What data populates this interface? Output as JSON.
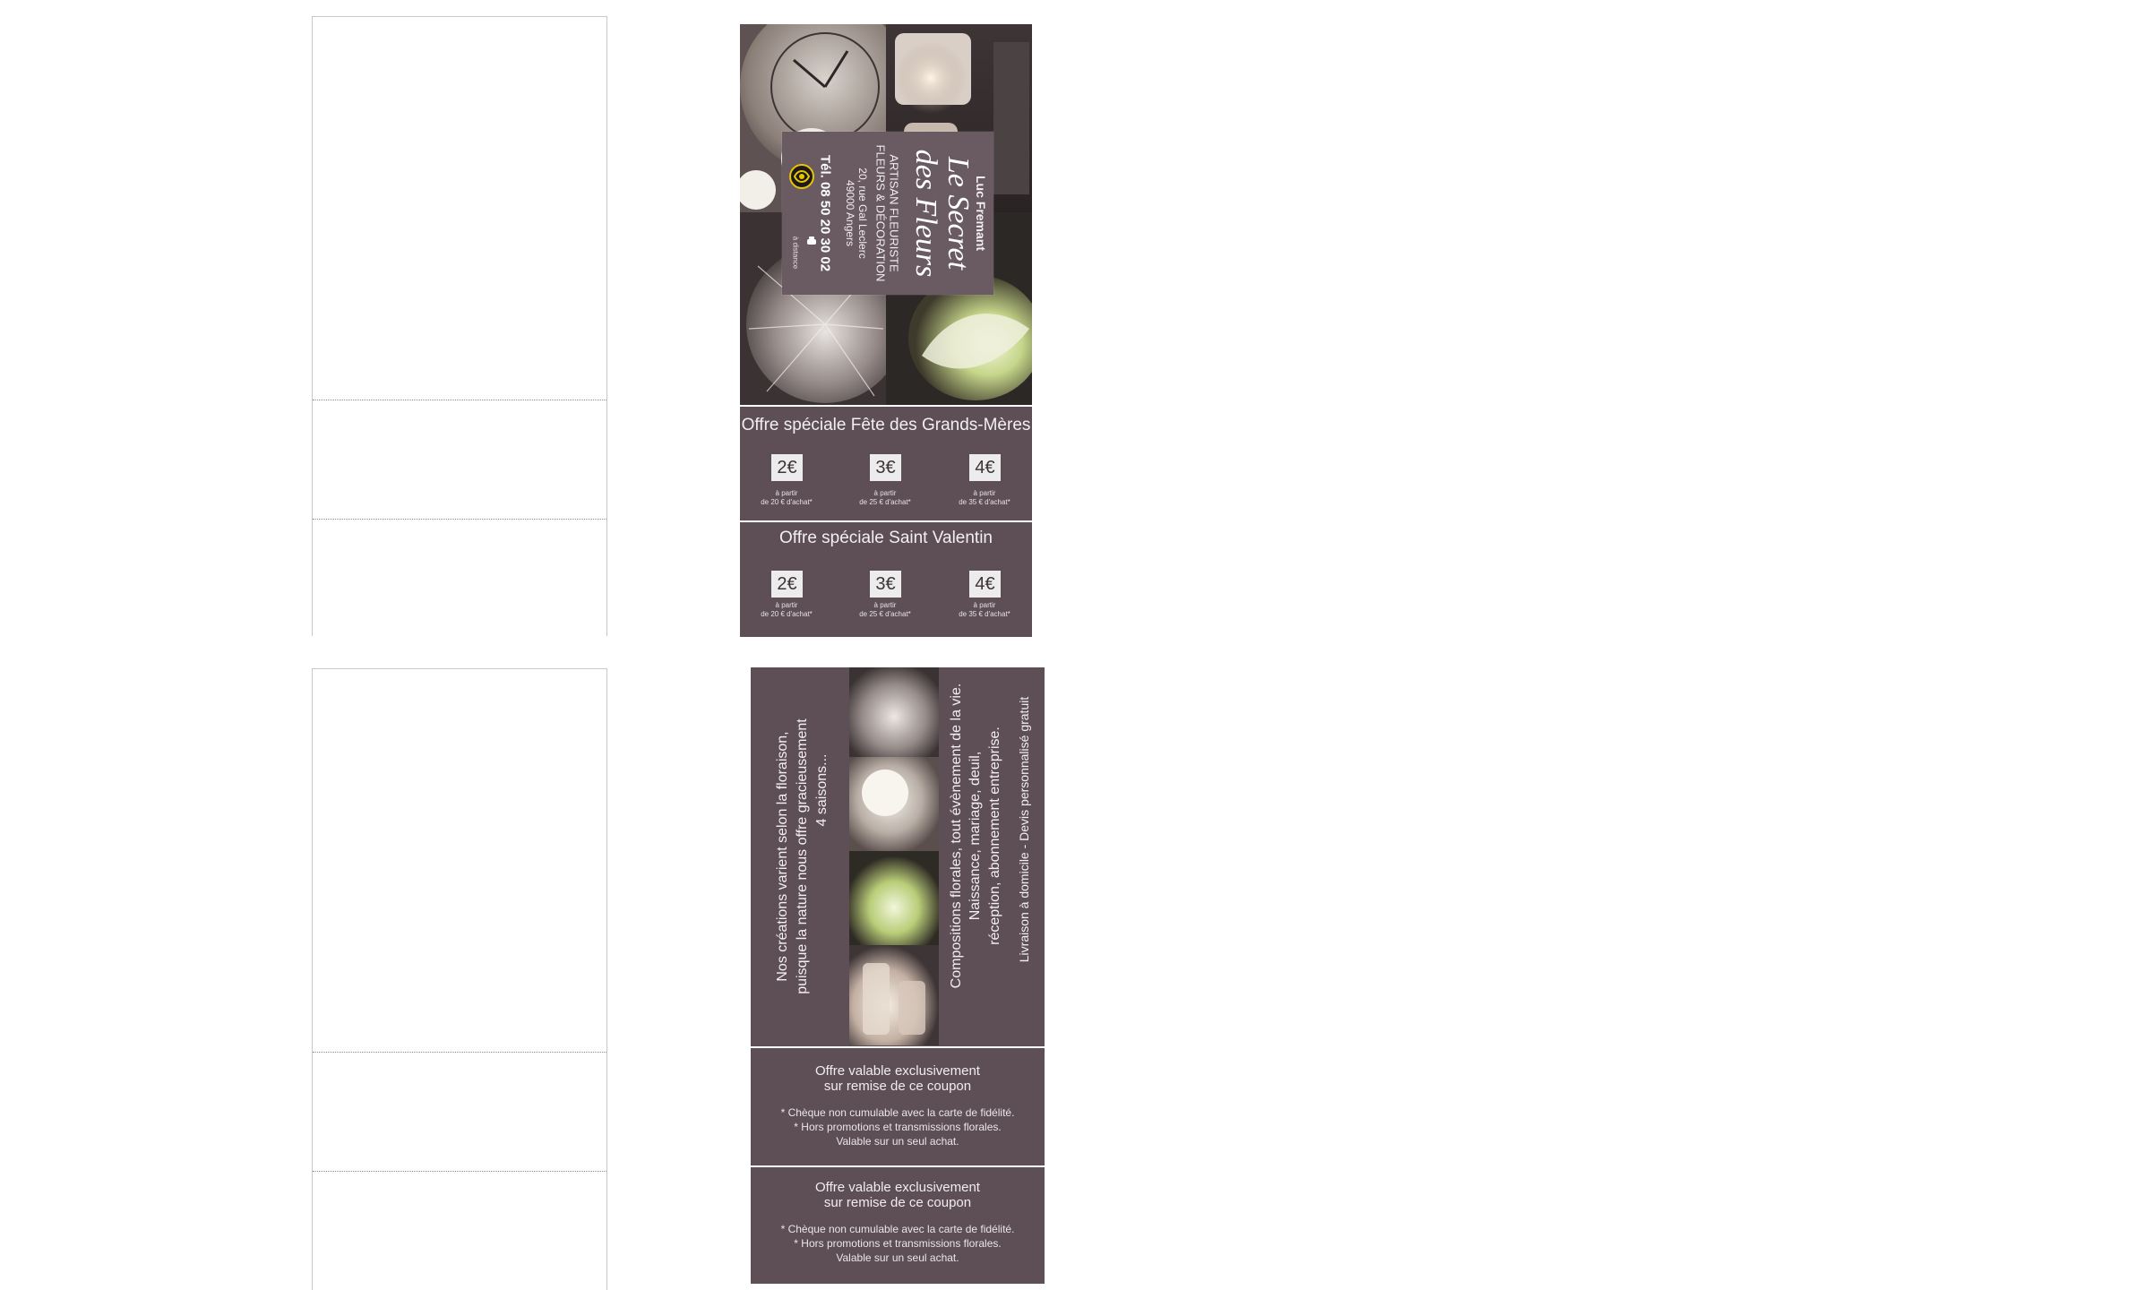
{
  "front_card": {
    "owner": "Luc Fremant",
    "brand_line1": "Le Secret",
    "brand_line2": "des Fleurs",
    "trade_line1": "ARTISAN FLEURISTE",
    "trade_line2": "FLEURS & DÉCORATION",
    "address_line1": "20, rue Gal Leclerc",
    "address_line2": "49000 Angers",
    "phone": "Tél. 08 50 20 30 02",
    "remote_label": "à distance"
  },
  "coupons": [
    {
      "title": "Offre spéciale Fête des Grands-Mères",
      "items": [
        {
          "price": "2€",
          "cond1": "à partir",
          "cond2": "de 20 € d'achat*"
        },
        {
          "price": "3€",
          "cond1": "à partir",
          "cond2": "de 25 € d'achat*"
        },
        {
          "price": "4€",
          "cond1": "à partir",
          "cond2": "de 35 € d'achat*"
        }
      ]
    },
    {
      "title": "Offre spéciale Saint Valentin",
      "items": [
        {
          "price": "2€",
          "cond1": "à partir",
          "cond2": "de 20 € d'achat*"
        },
        {
          "price": "3€",
          "cond1": "à partir",
          "cond2": "de 25 € d'achat*"
        },
        {
          "price": "4€",
          "cond1": "à partir",
          "cond2": "de 35 € d'achat*"
        }
      ]
    }
  ],
  "back_card": {
    "left_line1": "Nos créations varient selon la floraison,",
    "left_line2": "puisque la nature nous offre gracieusement",
    "left_line3": "4 saisons...",
    "right_line1": "Compositions florales, tout évènement de la vie.",
    "right_line2": "Naissance, mariage, deuil,",
    "right_line3": "réception, abonnement entreprise.",
    "right_line4": "Livraison à domicile - Devis personnalisé gratuit"
  },
  "validity_blocks": [
    {
      "title1": "Offre valable exclusivement",
      "title2": "sur remise de ce coupon",
      "note1": "* Chèque non cumulable avec la carte de fidélité.",
      "note2": "* Hors promotions et transmissions florales.",
      "note3": "Valable sur un seul achat."
    },
    {
      "title1": "Offre valable exclusivement",
      "title2": "sur remise de ce coupon",
      "note1": "* Chèque non cumulable avec la carte de fidélité.",
      "note2": "* Hors promotions et transmissions florales.",
      "note3": "Valable sur un seul achat."
    }
  ],
  "colors": {
    "card_bg": "#5d4f55",
    "text_light": "#f0ecee"
  }
}
